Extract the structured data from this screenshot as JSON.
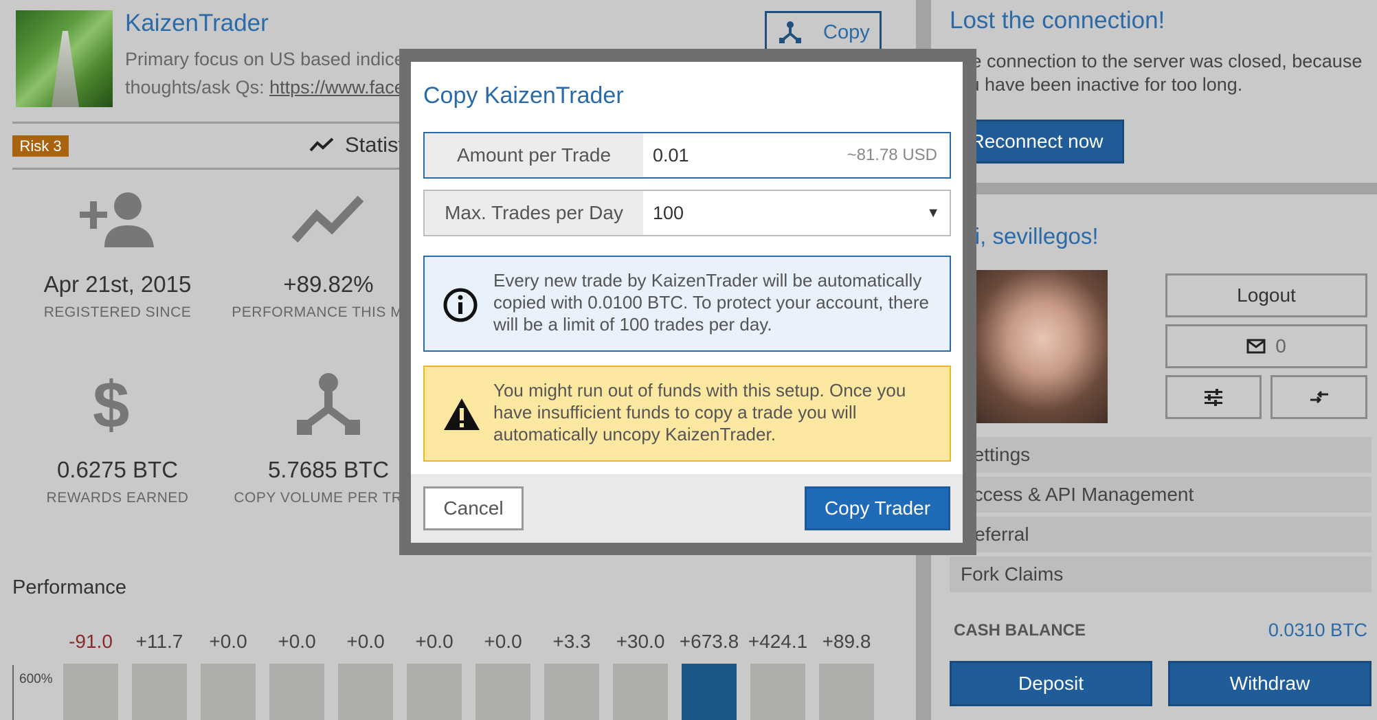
{
  "trader": {
    "name": "KaizenTrader",
    "description_line1": "Primary focus on US based indices and equities. For investors to share",
    "description_prefix": "thoughts/ask Qs:",
    "description_link": "https://www.face",
    "copy_button": "Copy",
    "risk_badge": "Risk 3",
    "stats_tab": "Statisti"
  },
  "stats": {
    "registered": {
      "value": "Apr 21st, 2015",
      "caption": "REGISTERED SINCE"
    },
    "performance": {
      "value": "+89.82%",
      "caption": "PERFORMANCE THIS MON"
    },
    "rewards": {
      "value": "0.6275 BTC",
      "caption": "REWARDS EARNED"
    },
    "copy_volume": {
      "value": "5.7685 BTC",
      "caption": "COPY VOLUME PER TRAD"
    }
  },
  "performance": {
    "title": "Performance",
    "axis_label": "600%",
    "bars": [
      "-91.0",
      "+11.7",
      "+0.0",
      "+0.0",
      "+0.0",
      "+0.0",
      "+0.0",
      "+3.3",
      "+30.0",
      "+673.8",
      "+424.1",
      "+89.8"
    ]
  },
  "connection": {
    "title": "Lost the connection!",
    "text": "The connection to the server was closed, because you have been inactive for too long.",
    "reconnect_button": "Reconnect now"
  },
  "user": {
    "greeting": "Hi, sevillegos!",
    "logout_button": "Logout",
    "messages_count": "0",
    "menu": [
      "Settings",
      "Access & API Management",
      "Referral",
      "Fork Claims"
    ],
    "cash_balance_label": "CASH BALANCE",
    "cash_balance_value": "0.0310 BTC",
    "deposit_button": "Deposit",
    "withdraw_button": "Withdraw"
  },
  "modal": {
    "title": "Copy KaizenTrader",
    "amount_label": "Amount per Trade",
    "amount_value": "0.01",
    "amount_hint": "~81.78 USD",
    "max_trades_label": "Max. Trades per Day",
    "max_trades_value": "100",
    "info_text": "Every new trade by KaizenTrader will be automatically copied with 0.0100 BTC. To protect your account, there will be a limit of 100 trades per day.",
    "warning_text": "You might run out of funds with this setup. Once you have insufficient funds to copy a trade you will automatically uncopy KaizenTrader.",
    "cancel_button": "Cancel",
    "copy_trader_button": "Copy Trader"
  },
  "colors": {
    "accent": "#2a6aa8",
    "highlight_bar": "#1d5785",
    "risk": "#a9630f"
  }
}
